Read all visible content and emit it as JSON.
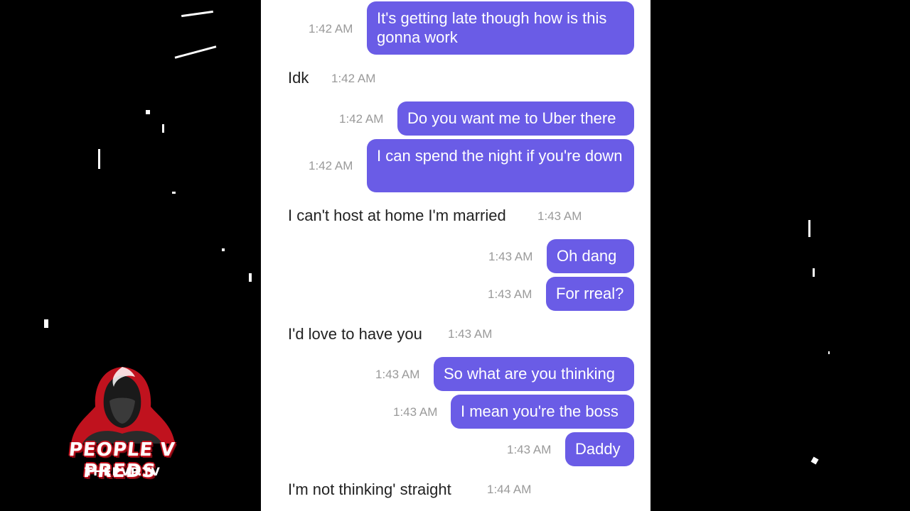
{
  "messages": [
    {
      "side": "sent",
      "text": "It's getting late though how is this gonna work",
      "time": "1:42 AM"
    },
    {
      "side": "recv",
      "text": "Idk",
      "time": "1:42 AM"
    },
    {
      "side": "sent",
      "text": "Do you want me to Uber there",
      "time": "1:42 AM"
    },
    {
      "side": "sent",
      "text": "I can spend the night if you're down",
      "time": "1:42 AM"
    },
    {
      "side": "recv",
      "text": "I can't host at home I'm married",
      "time": "1:43 AM"
    },
    {
      "side": "sent",
      "text": "Oh dang",
      "time": "1:43 AM"
    },
    {
      "side": "sent",
      "text": "For rreal?",
      "time": "1:43 AM"
    },
    {
      "side": "recv",
      "text": "I'd love to have you",
      "time": "1:43 AM"
    },
    {
      "side": "sent",
      "text": "So what are you thinking",
      "time": "1:43 AM"
    },
    {
      "side": "sent",
      "text": "I mean you're the boss",
      "time": "1:43 AM"
    },
    {
      "side": "sent",
      "text": "Daddy",
      "time": "1:43 AM"
    },
    {
      "side": "recv",
      "text": "I'm not thinking' straight",
      "time": "1:44 AM"
    }
  ],
  "watermark": {
    "title": "PEOPLE V PREDS",
    "subtitle": "THEPVP.TV"
  },
  "colors": {
    "bubble": "#6a5ce6",
    "background": "#ffffff",
    "logo_red": "#c0121e"
  }
}
